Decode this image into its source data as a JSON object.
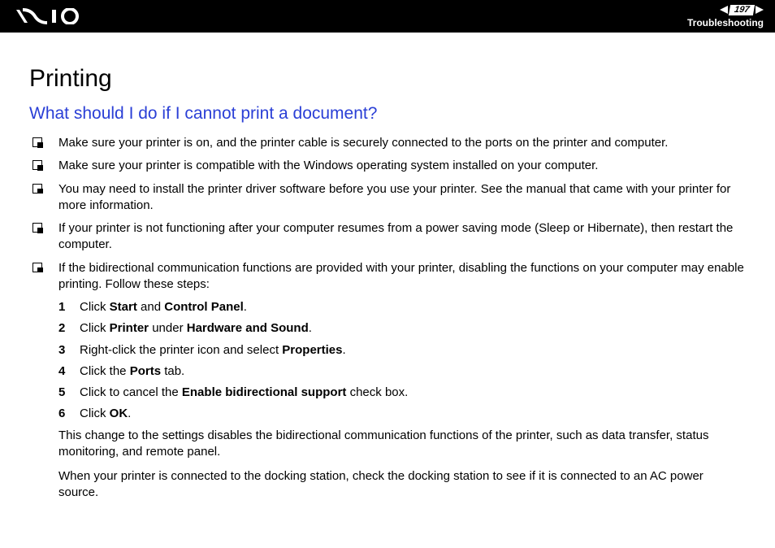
{
  "header": {
    "page_number": "197",
    "section": "Troubleshooting"
  },
  "content": {
    "title": "Printing",
    "question": "What should I do if I cannot print a document?",
    "bullets": [
      "Make sure your printer is on, and the printer cable is securely connected to the ports on the printer and computer.",
      "Make sure your printer is compatible with the Windows operating system installed on your computer.",
      "You may need to install the printer driver software before you use your printer. See the manual that came with your printer for more information.",
      "If your printer is not functioning after your computer resumes from a power saving mode (Sleep or Hibernate), then restart the computer.",
      "If the bidirectional communication functions are provided with your printer, disabling the functions on your computer may enable printing. Follow these steps:"
    ],
    "steps": [
      {
        "n": "1",
        "pre": "Click ",
        "b1": "Start",
        "mid": " and ",
        "b2": "Control Panel",
        "post": "."
      },
      {
        "n": "2",
        "pre": "Click ",
        "b1": "Printer",
        "mid": " under ",
        "b2": "Hardware and Sound",
        "post": "."
      },
      {
        "n": "3",
        "pre": "Right-click the printer icon and select ",
        "b1": "Properties",
        "mid": "",
        "b2": "",
        "post": "."
      },
      {
        "n": "4",
        "pre": "Click the ",
        "b1": "Ports",
        "mid": "",
        "b2": "",
        "post": " tab."
      },
      {
        "n": "5",
        "pre": "Click to cancel the ",
        "b1": "Enable bidirectional support",
        "mid": "",
        "b2": "",
        "post": " check box."
      },
      {
        "n": "6",
        "pre": "Click ",
        "b1": "OK",
        "mid": "",
        "b2": "",
        "post": "."
      }
    ],
    "post1": "This change to the settings disables the bidirectional communication functions of the printer, such as data transfer, status monitoring, and remote panel.",
    "post2": "When your printer is connected to the docking station, check the docking station to see if it is connected to an AC power source."
  }
}
